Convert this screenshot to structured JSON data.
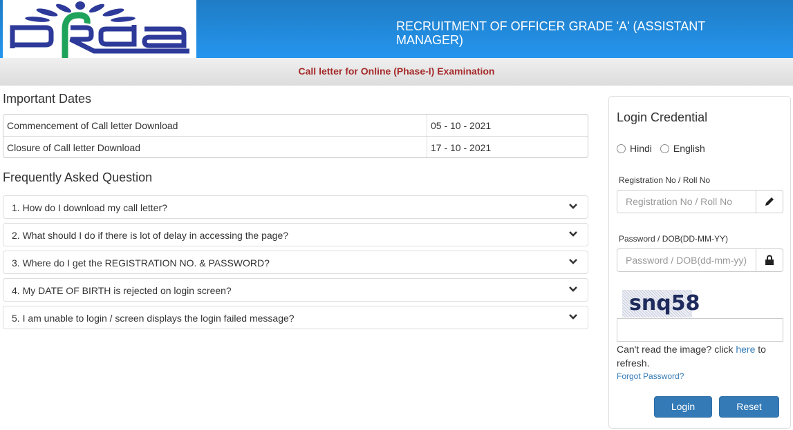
{
  "header": {
    "logo_text": "pfrda",
    "title": "RECRUITMENT OF OFFICER GRADE 'A' (ASSISTANT MANAGER)",
    "subtitle": "Call letter for Online (Phase-I) Examination",
    "colors": {
      "header_top": "#1f7cc5",
      "header_bottom": "#2595ee",
      "subtitle": "#a52a2a"
    }
  },
  "important_dates": {
    "heading": "Important Dates",
    "rows": [
      {
        "label": "Commencement of Call letter Download",
        "date": "05 - 10 - 2021"
      },
      {
        "label": "Closure of Call letter Download",
        "date": "17 - 10 - 2021"
      }
    ]
  },
  "faq": {
    "heading": "Frequently Asked Question",
    "items": [
      {
        "question": "1. How do I download my call letter?",
        "icon": "chevron-down-icon"
      },
      {
        "question": "2. What should I do if there is lot of delay in accessing the page?",
        "icon": "chevron-down-icon"
      },
      {
        "question": "3. Where do I get the REGISTRATION NO. & PASSWORD?",
        "icon": "chevron-down-icon"
      },
      {
        "question": "4. My DATE OF BIRTH is rejected on login screen?",
        "icon": "chevron-down-icon"
      },
      {
        "question": "5. I am unable to login / screen displays the login failed message?",
        "icon": "chevron-down-icon"
      }
    ]
  },
  "login": {
    "title": "Login Credential",
    "languages": [
      "Hindi",
      "English"
    ],
    "registration": {
      "label": "Registration No / Roll No",
      "placeholder": "Registration No / Roll No",
      "value": "",
      "icon": "pencil-icon"
    },
    "password": {
      "label": "Password / DOB(DD-MM-YY)",
      "placeholder": "Password / DOB(dd-mm-yy)",
      "value": "",
      "icon": "lock-icon"
    },
    "captcha_text": "snq58",
    "captcha_value": "",
    "refresh_prefix": "Can't read the image? click ",
    "refresh_link": "here",
    "refresh_suffix": " to refresh.",
    "forgot_password": "Forgot Password?",
    "login_button": "Login",
    "reset_button": "Reset",
    "button_color": "#337ab7"
  }
}
